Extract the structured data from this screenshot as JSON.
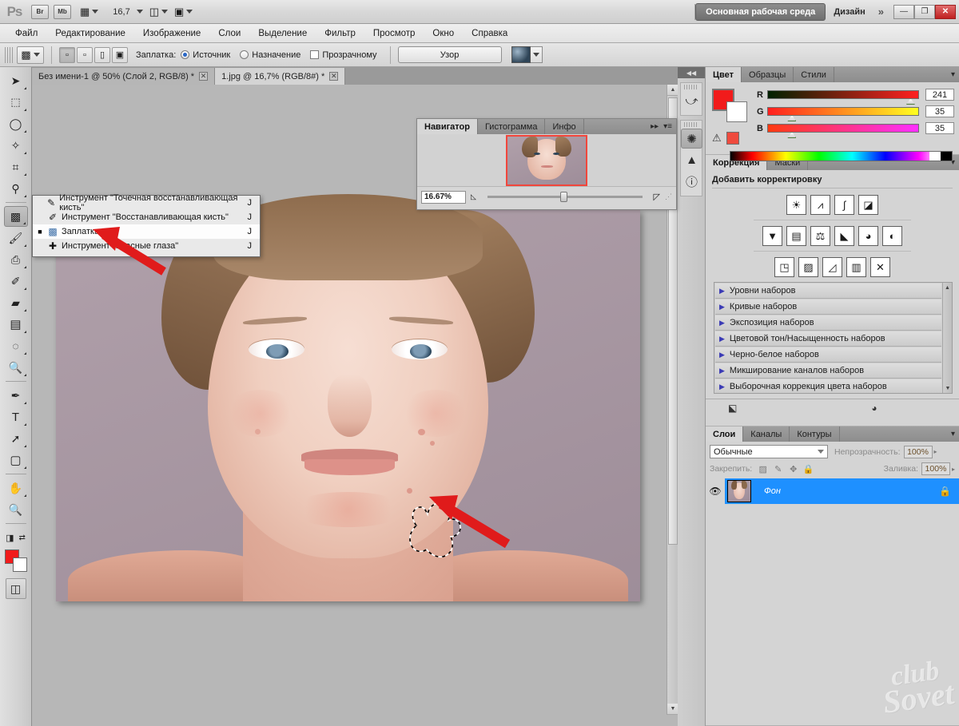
{
  "app": {
    "logo": "Ps",
    "workspace_active": "Основная рабочая среда",
    "workspace_other": "Дизайн",
    "more_chevron": "»",
    "zoom_level": "16,7",
    "bridge_label": "Br",
    "minibridge_label": "Mb",
    "window_buttons": {
      "minimize": "—",
      "maximize": "❐",
      "close": "✕"
    }
  },
  "menubar": {
    "items": [
      "Файл",
      "Редактирование",
      "Изображение",
      "Слои",
      "Выделение",
      "Фильтр",
      "Просмотр",
      "Окно",
      "Справка"
    ]
  },
  "options_bar": {
    "tool_label": "Заплатка:",
    "source_label": "Источник",
    "destination_label": "Назначение",
    "transparent_label": "Прозрачному",
    "pattern_button": "Узор",
    "source_selected": true,
    "destination_selected": false,
    "transparent_checked": false
  },
  "tabs": [
    {
      "title": "Без имени-1 @ 50% (Слой 2, RGB/8) *",
      "active": false,
      "close": "✕"
    },
    {
      "title": "1.jpg @ 16,7% (RGB/8#) *",
      "active": true,
      "close": "✕"
    }
  ],
  "toolbar": {
    "tools": [
      {
        "name": "move-tool",
        "glyph": "➤",
        "selected": false
      },
      {
        "name": "marquee-tool",
        "glyph": "▭",
        "selected": false
      },
      {
        "name": "lasso-tool",
        "glyph": "◯",
        "selected": false
      },
      {
        "name": "quick-selection-tool",
        "glyph": "✦",
        "selected": false
      },
      {
        "name": "crop-tool",
        "glyph": "⌗",
        "selected": false
      },
      {
        "name": "eyedropper-tool",
        "glyph": "✒",
        "selected": false
      },
      {
        "name": "patch-tool",
        "glyph": "▩",
        "selected": true
      },
      {
        "name": "brush-tool",
        "glyph": "✎",
        "selected": false
      },
      {
        "name": "clone-stamp-tool",
        "glyph": "⎙",
        "selected": false
      },
      {
        "name": "history-brush-tool",
        "glyph": "✐",
        "selected": false
      },
      {
        "name": "eraser-tool",
        "glyph": "▱",
        "selected": false
      },
      {
        "name": "gradient-tool",
        "glyph": "▤",
        "selected": false
      },
      {
        "name": "blur-tool",
        "glyph": "💧",
        "selected": false
      },
      {
        "name": "dodge-tool",
        "glyph": "◔",
        "selected": false
      },
      {
        "name": "pen-tool",
        "glyph": "✑",
        "selected": false
      },
      {
        "name": "type-tool",
        "glyph": "T",
        "selected": false
      },
      {
        "name": "path-selection-tool",
        "glyph": "➚",
        "selected": false
      },
      {
        "name": "shape-tool",
        "glyph": "▢",
        "selected": false
      },
      {
        "name": "hand-tool",
        "glyph": "✋",
        "selected": false
      },
      {
        "name": "zoom-tool",
        "glyph": "🔍",
        "selected": false
      }
    ],
    "foreground_color": "#f11b1b",
    "background_color": "#ffffff",
    "quickmask_glyph": "◫",
    "screenmode_glyph": "▣"
  },
  "flyout": {
    "items": [
      {
        "label": "Инструмент \"Точечная восстанавливающая кисть\"",
        "shortcut": "J",
        "icon": "spot-healing-brush-icon",
        "selected": false
      },
      {
        "label": "Инструмент \"Восстанавливающая кисть\"",
        "shortcut": "J",
        "icon": "healing-brush-icon",
        "selected": false
      },
      {
        "label": "Заплатка",
        "shortcut": "J",
        "icon": "patch-icon",
        "selected": true
      },
      {
        "label": "Инструмент \"Красные глаза\"",
        "shortcut": "J",
        "icon": "red-eye-icon",
        "selected": false
      }
    ]
  },
  "navigator": {
    "tabs": [
      "Навигатор",
      "Гистограмма",
      "Инфо"
    ],
    "active_tab": "Навигатор",
    "zoom_value": "16.67%",
    "collapse_glyph": "▸▸",
    "menu_glyph": "▾≡"
  },
  "dock": {
    "collapse_glyph": "◀◀",
    "icons": [
      {
        "name": "history-icon",
        "glyph": "⤻",
        "active": false
      },
      {
        "name": "adjustments-icon",
        "glyph": "✺",
        "active": true
      },
      {
        "name": "histogram-icon",
        "glyph": "▲",
        "active": false
      },
      {
        "name": "info-icon",
        "glyph": "ⓘ",
        "active": false
      }
    ]
  },
  "color_panel": {
    "tabs": [
      "Цвет",
      "Образцы",
      "Стили"
    ],
    "active_tab": "Цвет",
    "channels": [
      {
        "label": "R",
        "value": "241",
        "knob_pct": 94
      },
      {
        "label": "G",
        "value": "35",
        "knob_pct": 14
      },
      {
        "label": "B",
        "value": "35",
        "knob_pct": 14
      }
    ],
    "foreground": "#f11b1b",
    "background": "#ffffff",
    "warning_glyph": "⚠",
    "warning_color": "#ef4b3e"
  },
  "adjustments_panel": {
    "tabs": [
      "Коррекция",
      "Маски"
    ],
    "active_tab": "Коррекция",
    "title": "Добавить корректировку",
    "icons_row1": [
      {
        "name": "brightness-contrast-icon",
        "glyph": "☀"
      },
      {
        "name": "levels-icon",
        "glyph": "⩘"
      },
      {
        "name": "curves-icon",
        "glyph": "∫"
      },
      {
        "name": "exposure-icon",
        "glyph": "◪"
      }
    ],
    "icons_row2": [
      {
        "name": "vibrance-icon",
        "glyph": "▼"
      },
      {
        "name": "hue-saturation-icon",
        "glyph": "▤"
      },
      {
        "name": "color-balance-icon",
        "glyph": "⚖"
      },
      {
        "name": "black-white-icon",
        "glyph": "◣"
      },
      {
        "name": "photo-filter-icon",
        "glyph": "◕"
      },
      {
        "name": "channel-mixer-icon",
        "glyph": "◐"
      }
    ],
    "icons_row3": [
      {
        "name": "invert-icon",
        "glyph": "◳"
      },
      {
        "name": "posterize-icon",
        "glyph": "▨"
      },
      {
        "name": "threshold-icon",
        "glyph": "◿"
      },
      {
        "name": "gradient-map-icon",
        "glyph": "▥"
      },
      {
        "name": "selective-color-icon",
        "glyph": "✕"
      }
    ],
    "presets": [
      "Уровни наборов",
      "Кривые наборов",
      "Экспозиция наборов",
      "Цветовой тон/Насыщенность наборов",
      "Черно-белое наборов",
      "Микширование каналов наборов",
      "Выборочная коррекция цвета наборов"
    ],
    "footer_icons": [
      {
        "name": "clip-to-layer-icon",
        "glyph": "⬕"
      },
      {
        "name": "preview-toggle-icon",
        "glyph": "◕"
      }
    ]
  },
  "layers_panel": {
    "tabs": [
      "Слои",
      "Каналы",
      "Контуры"
    ],
    "active_tab": "Слои",
    "blend_mode": "Обычные",
    "opacity_label": "Непрозрачность:",
    "opacity_value": "100%",
    "lock_label": "Закрепить:",
    "fill_label": "Заливка:",
    "fill_value": "100%",
    "lock_icons": [
      {
        "name": "lock-transparency-icon",
        "glyph": "▨"
      },
      {
        "name": "lock-image-icon",
        "glyph": "✎"
      },
      {
        "name": "lock-position-icon",
        "glyph": "✥"
      },
      {
        "name": "lock-all-icon",
        "glyph": "🔒"
      }
    ],
    "layers": [
      {
        "name": "Фон",
        "visible": true,
        "locked": true,
        "lock_glyph": "🔒",
        "eye_glyph": "👁"
      }
    ]
  },
  "watermark": {
    "line1": "club",
    "line2": "Sovet"
  }
}
